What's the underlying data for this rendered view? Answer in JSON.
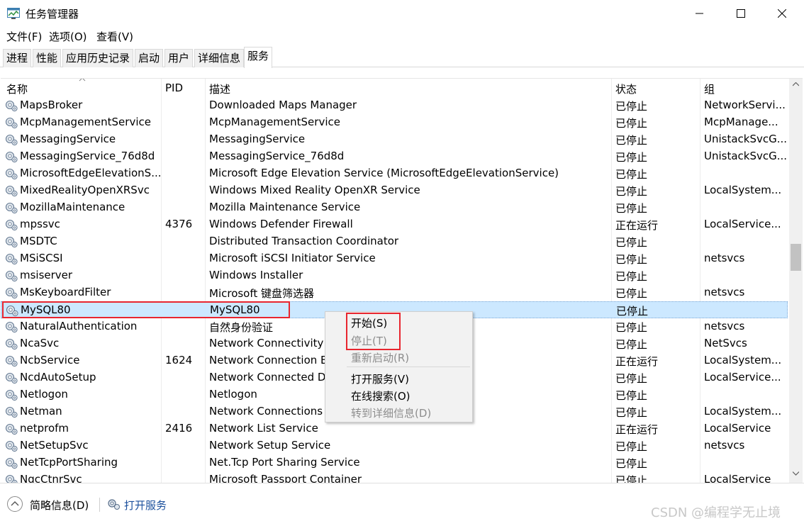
{
  "window": {
    "title": "任务管理器"
  },
  "menu": [
    "文件(F)",
    "选项(O)",
    "查看(V)"
  ],
  "tabs": [
    "进程",
    "性能",
    "应用历史记录",
    "启动",
    "用户",
    "详细信息",
    "服务"
  ],
  "columns": {
    "name": "名称",
    "pid": "PID",
    "desc": "描述",
    "status": "状态",
    "group": "组"
  },
  "services": [
    {
      "name": "MapsBroker",
      "pid": "",
      "desc": "Downloaded Maps Manager",
      "status": "已停止",
      "group": "NetworkServi..."
    },
    {
      "name": "McpManagementService",
      "pid": "",
      "desc": "McpManagementService",
      "status": "已停止",
      "group": "McpManage..."
    },
    {
      "name": "MessagingService",
      "pid": "",
      "desc": "MessagingService",
      "status": "已停止",
      "group": "UnistackSvcG..."
    },
    {
      "name": "MessagingService_76d8d",
      "pid": "",
      "desc": "MessagingService_76d8d",
      "status": "已停止",
      "group": "UnistackSvcG..."
    },
    {
      "name": "MicrosoftEdgeElevationS...",
      "pid": "",
      "desc": "Microsoft Edge Elevation Service (MicrosoftEdgeElevationService)",
      "status": "已停止",
      "group": ""
    },
    {
      "name": "MixedRealityOpenXRSvc",
      "pid": "",
      "desc": "Windows Mixed Reality OpenXR Service",
      "status": "已停止",
      "group": "LocalSystem..."
    },
    {
      "name": "MozillaMaintenance",
      "pid": "",
      "desc": "Mozilla Maintenance Service",
      "status": "已停止",
      "group": ""
    },
    {
      "name": "mpssvc",
      "pid": "4376",
      "desc": "Windows Defender Firewall",
      "status": "正在运行",
      "group": "LocalService..."
    },
    {
      "name": "MSDTC",
      "pid": "",
      "desc": "Distributed Transaction Coordinator",
      "status": "已停止",
      "group": ""
    },
    {
      "name": "MSiSCSI",
      "pid": "",
      "desc": "Microsoft iSCSI Initiator Service",
      "status": "已停止",
      "group": "netsvcs"
    },
    {
      "name": "msiserver",
      "pid": "",
      "desc": "Windows Installer",
      "status": "已停止",
      "group": ""
    },
    {
      "name": "MsKeyboardFilter",
      "pid": "",
      "desc": "Microsoft 键盘筛选器",
      "status": "已停止",
      "group": "netsvcs"
    },
    {
      "name": "MySQL80",
      "pid": "",
      "desc": "MySQL80",
      "status": "已停止",
      "group": ""
    },
    {
      "name": "NaturalAuthentication",
      "pid": "",
      "desc": "自然身份验证",
      "status": "已停止",
      "group": "netsvcs"
    },
    {
      "name": "NcaSvc",
      "pid": "",
      "desc": "Network Connectivity A",
      "status": "已停止",
      "group": "NetSvcs"
    },
    {
      "name": "NcbService",
      "pid": "1624",
      "desc": "Network Connection B",
      "status": "正在运行",
      "group": "LocalSystem..."
    },
    {
      "name": "NcdAutoSetup",
      "pid": "",
      "desc": "Network Connected D",
      "status": "已停止",
      "group": "LocalService..."
    },
    {
      "name": "Netlogon",
      "pid": "",
      "desc": "Netlogon",
      "status": "已停止",
      "group": ""
    },
    {
      "name": "Netman",
      "pid": "",
      "desc": "Network Connections",
      "status": "已停止",
      "group": "LocalSystem..."
    },
    {
      "name": "netprofm",
      "pid": "2416",
      "desc": "Network List Service",
      "status": "正在运行",
      "group": "LocalService"
    },
    {
      "name": "NetSetupSvc",
      "pid": "",
      "desc": "Network Setup Service",
      "status": "已停止",
      "group": "netsvcs"
    },
    {
      "name": "NetTcpPortSharing",
      "pid": "",
      "desc": "Net.Tcp Port Sharing Service",
      "status": "已停止",
      "group": ""
    },
    {
      "name": "NgcCtnrSvc",
      "pid": "",
      "desc": "Microsoft Passport Container",
      "status": "已停止",
      "group": "LocalService"
    }
  ],
  "context_menu": {
    "start": "开始(S)",
    "stop": "停止(T)",
    "restart": "重新启动(R)",
    "open_services": "打开服务(V)",
    "search_online": "在线搜索(O)",
    "goto_details": "转到详细信息(D)"
  },
  "footer": {
    "summary": "简略信息(D)",
    "open_services": "打开服务"
  },
  "watermark": "CSDN @编程学无止境",
  "colors": {
    "selection": "#cce8ff",
    "highlight_box": "#e8262f",
    "link": "#1a4f9c"
  }
}
